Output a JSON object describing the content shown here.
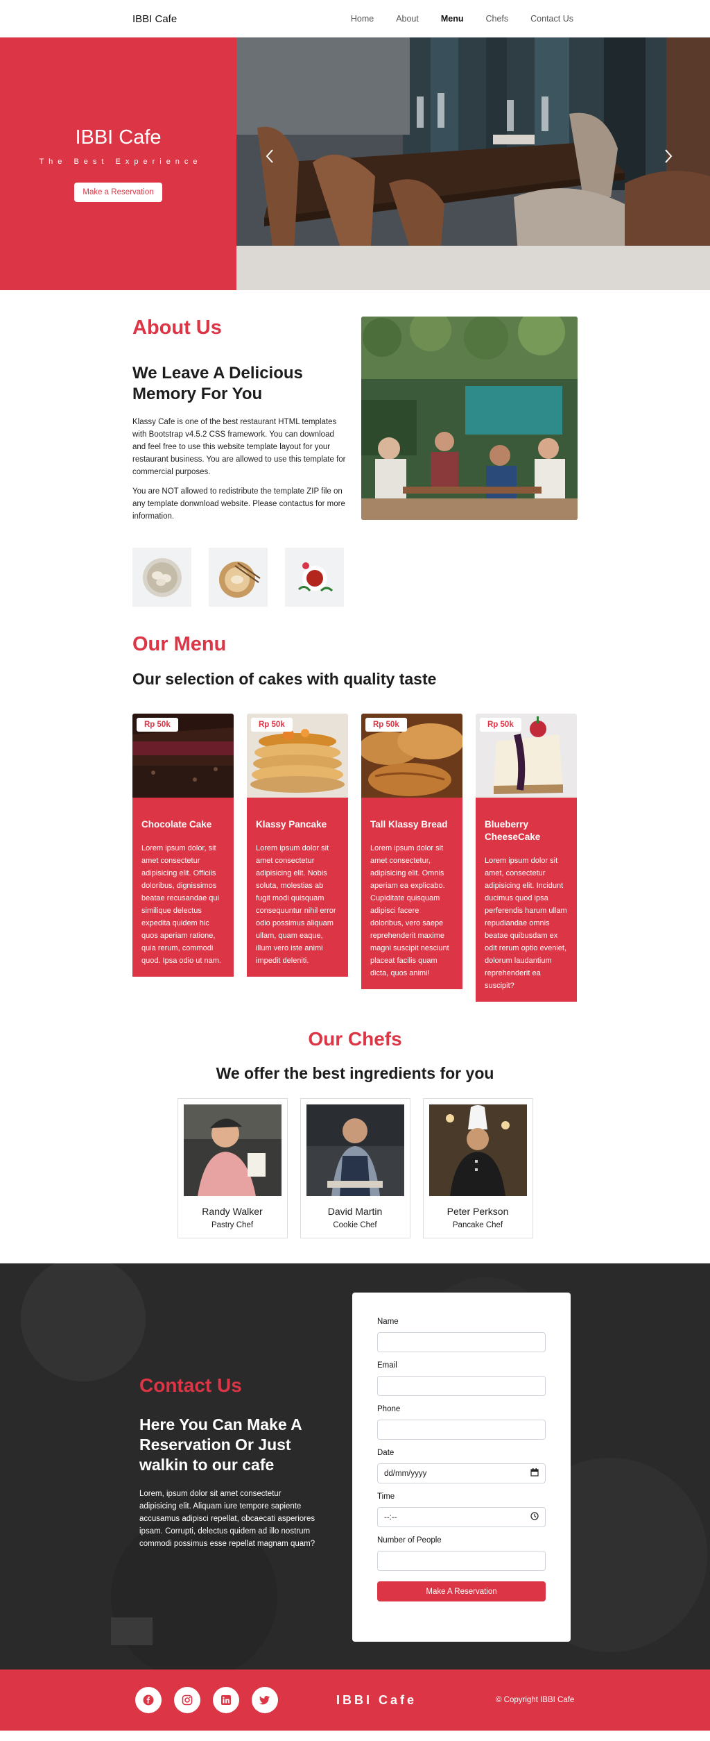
{
  "navbar": {
    "brand": "IBBI Cafe",
    "links": [
      "Home",
      "About",
      "Menu",
      "Chefs",
      "Contact Us"
    ],
    "active": "Menu"
  },
  "hero": {
    "title": "IBBI Cafe",
    "tagline": "The Best Experience",
    "button": "Make a Reservation"
  },
  "about": {
    "title": "About Us",
    "heading": "We Leave A Delicious Memory For You",
    "paragraph1": "Klassy Cafe is one of the best restaurant HTML templates with Bootstrap v4.5.2 CSS framework. You can download and feel free to use this website template layout for your restaurant business. You are allowed to use this template for commercial purposes.",
    "paragraph2": "You are NOT allowed to redistribute the template ZIP file on any template donwnload website. Please contactus for more information."
  },
  "menu": {
    "title": "Our Menu",
    "subtitle": "Our selection of cakes with quality taste",
    "items": [
      {
        "price": "Rp 50k",
        "name": "Chocolate Cake",
        "text": "Lorem ipsum dolor, sit amet consectetur adipisicing elit. Officiis doloribus, dignissimos beatae recusandae qui similique delectus expedita quidem hic quos aperiam ratione, quia rerum, commodi quod. Ipsa odio ut nam."
      },
      {
        "price": "Rp 50k",
        "name": "Klassy Pancake",
        "text": "Lorem ipsum dolor sit amet consectetur adipisicing elit. Nobis soluta, molestias ab fugit modi quisquam consequuntur nihil error odio possimus aliquam ullam, quam eaque, illum vero iste animi impedit deleniti."
      },
      {
        "price": "Rp 50k",
        "name": "Tall Klassy Bread",
        "text": "Lorem ipsum dolor sit amet consectetur, adipisicing elit. Omnis aperiam ea explicabo. Cupiditate quisquam adipisci facere doloribus, vero saepe reprehenderit maxime magni suscipit nesciunt placeat facilis quam dicta, quos animi!"
      },
      {
        "price": "Rp 50k",
        "name": "Blueberry CheeseCake",
        "text": "Lorem ipsum dolor sit amet, consectetur adipisicing elit. Incidunt ducimus quod ipsa perferendis harum ullam repudiandae omnis beatae quibusdam ex odit rerum optio eveniet, dolorum laudantium reprehenderit ea suscipit?"
      }
    ]
  },
  "chefs": {
    "title": "Our Chefs",
    "subtitle": "We offer the best ingredients for you",
    "list": [
      {
        "name": "Randy Walker",
        "role": "Pastry Chef"
      },
      {
        "name": "David Martin",
        "role": "Cookie Chef"
      },
      {
        "name": "Peter Perkson",
        "role": "Pancake Chef"
      }
    ]
  },
  "contact": {
    "title": "Contact Us",
    "heading": "Here You Can Make A Reservation Or Just walkin to our cafe",
    "paragraph": "Lorem, ipsum dolor sit amet consectetur adipisicing elit. Aliquam iure tempore sapiente accusamus adipisci repellat, obcaecati asperiores ipsam. Corrupti, delectus quidem ad illo nostrum commodi possimus esse repellat magnam quam?",
    "form": {
      "name_label": "Name",
      "email_label": "Email",
      "phone_label": "Phone",
      "date_label": "Date",
      "date_value": "dd/mm/yyyy",
      "time_label": "Time",
      "time_value": "--:--",
      "people_label": "Number of People",
      "submit": "Make A Reservation"
    }
  },
  "footer": {
    "socials": [
      "facebook-icon",
      "instagram-icon",
      "linkedin-icon",
      "twitter-icon"
    ],
    "brand": "IBBI Cafe",
    "copyright": "© Copyright IBBI Cafe"
  },
  "colors": {
    "accent": "#dc3545",
    "dark": "#2b2b2b"
  }
}
